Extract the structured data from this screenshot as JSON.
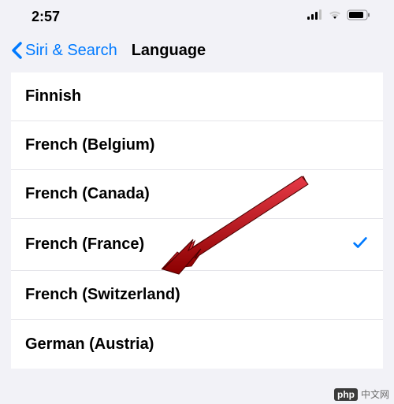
{
  "status": {
    "time": "2:57"
  },
  "nav": {
    "back_label": "Siri & Search",
    "title": "Language"
  },
  "languages": [
    {
      "label": "Finnish",
      "selected": false
    },
    {
      "label": "French (Belgium)",
      "selected": false
    },
    {
      "label": "French (Canada)",
      "selected": false
    },
    {
      "label": "French (France)",
      "selected": true
    },
    {
      "label": "French (Switzerland)",
      "selected": false
    },
    {
      "label": "German (Austria)",
      "selected": false
    }
  ],
  "watermark": {
    "logo": "php",
    "text": "中文网"
  },
  "colors": {
    "accent": "#007aff",
    "arrow": "#c1272d"
  }
}
